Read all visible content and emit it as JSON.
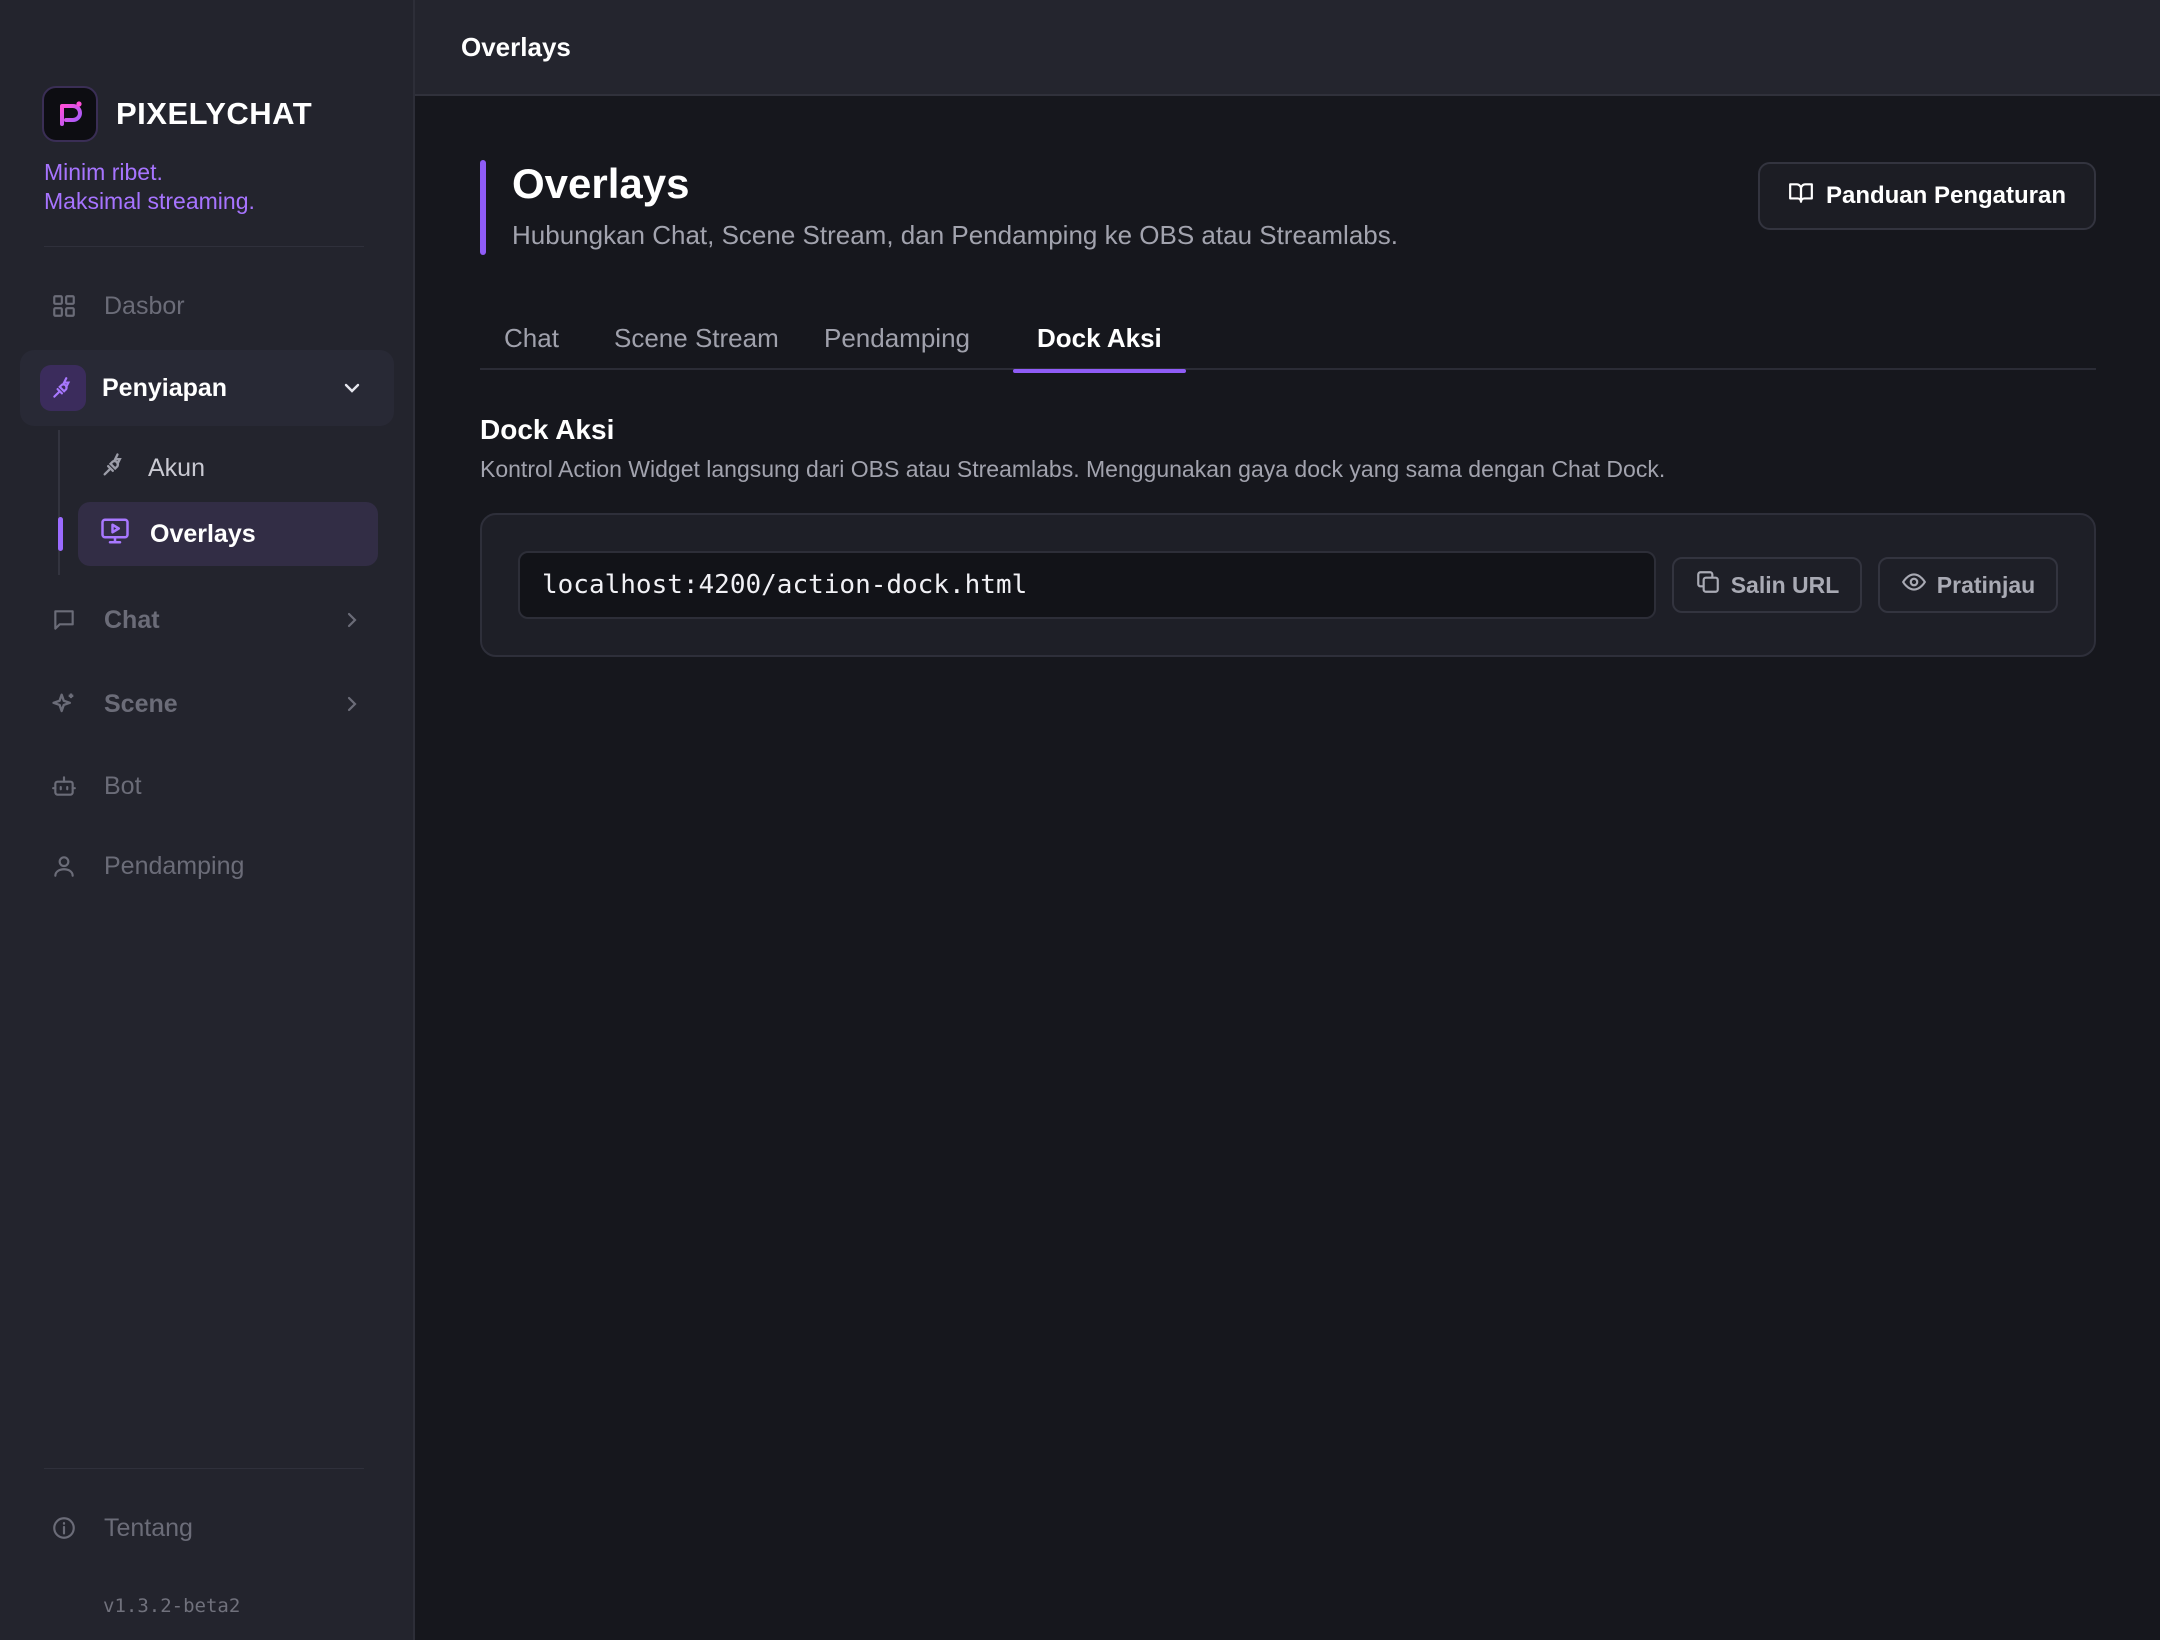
{
  "app": {
    "brand_name": "PIXELYCHAT",
    "tagline_line1": "Minim ribet.",
    "tagline_line2": "Maksimal streaming.",
    "version": "v1.3.2-beta2",
    "accent_color": "#8f5cf6"
  },
  "sidebar": {
    "items": [
      {
        "label": "Dasbor",
        "icon": "grid-icon"
      },
      {
        "label": "Penyiapan",
        "icon": "plug-icon",
        "expanded": true,
        "children": [
          {
            "label": "Akun",
            "icon": "plug-icon"
          },
          {
            "label": "Overlays",
            "icon": "monitor-play-icon",
            "active": true
          }
        ]
      },
      {
        "label": "Chat",
        "icon": "message-icon",
        "has_children": true
      },
      {
        "label": "Scene",
        "icon": "sparkles-icon",
        "has_children": true
      },
      {
        "label": "Bot",
        "icon": "bot-icon"
      },
      {
        "label": "Pendamping",
        "icon": "user-icon"
      }
    ],
    "footer": {
      "label": "Tentang",
      "icon": "info-icon"
    }
  },
  "topbar": {
    "title": "Overlays"
  },
  "header": {
    "title": "Overlays",
    "subtitle": "Hubungkan Chat, Scene Stream, dan Pendamping ke OBS atau Streamlabs.",
    "guide_button": "Panduan Pengaturan"
  },
  "tabs": [
    {
      "label": "Chat"
    },
    {
      "label": "Scene Stream"
    },
    {
      "label": "Pendamping"
    },
    {
      "label": "Dock Aksi",
      "active": true
    }
  ],
  "section": {
    "title": "Dock Aksi",
    "description": "Kontrol Action Widget langsung dari OBS atau Streamlabs. Menggunakan gaya dock yang sama dengan Chat Dock.",
    "url_value": "localhost:4200/action-dock.html",
    "copy_button": "Salin URL",
    "preview_button": "Pratinjau"
  }
}
